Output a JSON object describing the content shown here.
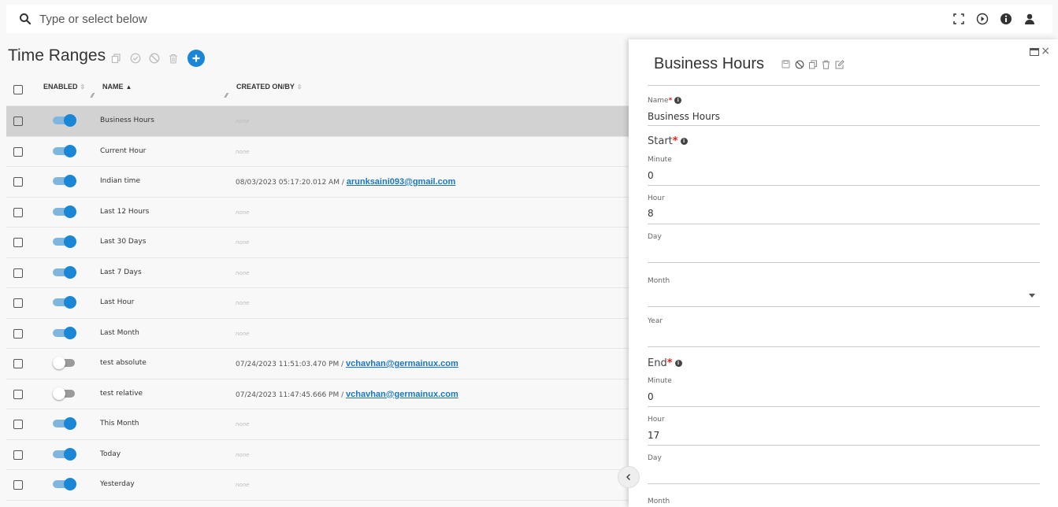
{
  "search": {
    "placeholder": "Type or select below"
  },
  "page": {
    "title": "Time Ranges"
  },
  "table": {
    "headers": {
      "enabled": "ENABLED",
      "name": "NAME",
      "created": "CREATED ON/BY"
    },
    "none_text": "none",
    "rows": [
      {
        "name": "Business Hours",
        "enabled": true,
        "created": "",
        "by": ""
      },
      {
        "name": "Current Hour",
        "enabled": true,
        "created": "",
        "by": ""
      },
      {
        "name": "Indian time",
        "enabled": true,
        "created": "08/03/2023 05:17:20.012 AM / ",
        "by": "arunksaini093@gmail.com"
      },
      {
        "name": "Last 12 Hours",
        "enabled": true,
        "created": "",
        "by": ""
      },
      {
        "name": "Last 30 Days",
        "enabled": true,
        "created": "",
        "by": ""
      },
      {
        "name": "Last 7 Days",
        "enabled": true,
        "created": "",
        "by": ""
      },
      {
        "name": "Last Hour",
        "enabled": true,
        "created": "",
        "by": ""
      },
      {
        "name": "Last Month",
        "enabled": true,
        "created": "",
        "by": ""
      },
      {
        "name": "test absolute",
        "enabled": false,
        "created": "07/24/2023 11:51:03.470 PM / ",
        "by": "vchavhan@germainux.com"
      },
      {
        "name": "test relative",
        "enabled": false,
        "created": "07/24/2023 11:47:45.666 PM / ",
        "by": "vchavhan@germainux.com"
      },
      {
        "name": "This Month",
        "enabled": true,
        "created": "",
        "by": ""
      },
      {
        "name": "Today",
        "enabled": true,
        "created": "",
        "by": ""
      },
      {
        "name": "Yesterday",
        "enabled": true,
        "created": "",
        "by": ""
      }
    ]
  },
  "panel": {
    "title": "Business Hours",
    "name_label": "Name",
    "name_value": "Business Hours",
    "start_label": "Start",
    "end_label": "End",
    "start": {
      "minute_label": "Minute",
      "minute": "0",
      "hour_label": "Hour",
      "hour": "8",
      "day_label": "Day",
      "day": "",
      "month_label": "Month",
      "month": "",
      "year_label": "Year",
      "year": ""
    },
    "end": {
      "minute_label": "Minute",
      "minute": "0",
      "hour_label": "Hour",
      "hour": "17",
      "day_label": "Day",
      "day": "",
      "month_label": "Month"
    },
    "required_mark": "*",
    "close_glyph": "×"
  },
  "colors": {
    "accent": "#1a86d6",
    "toggle_track_on": "#7fb6de",
    "selected_row": "#d2d2d2",
    "required": "#d9241c",
    "link": "#1a76c2"
  }
}
